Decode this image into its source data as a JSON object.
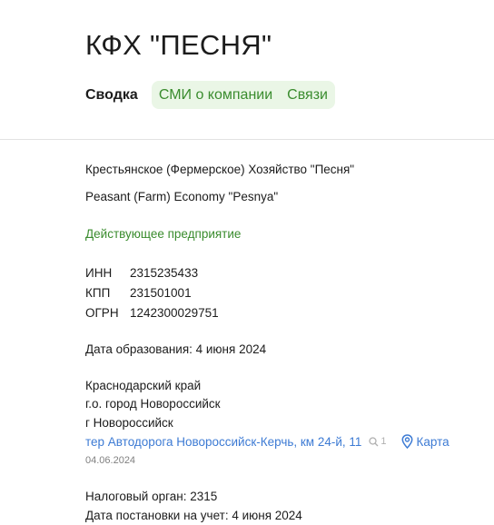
{
  "header": {
    "title": "КФХ \"ПЕСНЯ\"",
    "tabs": {
      "active": "Сводка",
      "media": "СМИ о компании",
      "links": "Связи"
    }
  },
  "company": {
    "full_name_ru": "Крестьянское (Фермерское) Хозяйство \"Песня\"",
    "full_name_en": "Peasant (Farm) Economy \"Pesnya\"",
    "status": "Действующее предприятие",
    "ids": [
      {
        "label": "ИНН",
        "value": "2315235433"
      },
      {
        "label": "КПП",
        "value": "231501001"
      },
      {
        "label": "ОГРН",
        "value": "1242300029751"
      }
    ],
    "founded": "Дата образования: 4 июня 2024",
    "address": {
      "region": "Краснодарский край",
      "district": "г.о. город Новороссийск",
      "city": "г Новороссийск",
      "street": "тер Автодорога Новороссийск-Керчь, км 24-й, 11",
      "same_address_count": "1",
      "map_label": "Карта",
      "date": "04.06.2024"
    },
    "tax_office": "Налоговый орган: 2315",
    "tax_registration": "Дата постановки на учет: 4 июня 2024"
  },
  "colors": {
    "accent_green": "#3a8c2e",
    "tab_bg": "#eaf6e6",
    "link_blue": "#3d7bd4"
  },
  "icons": {
    "search": "magnifier-icon",
    "map": "map-pin-icon"
  }
}
